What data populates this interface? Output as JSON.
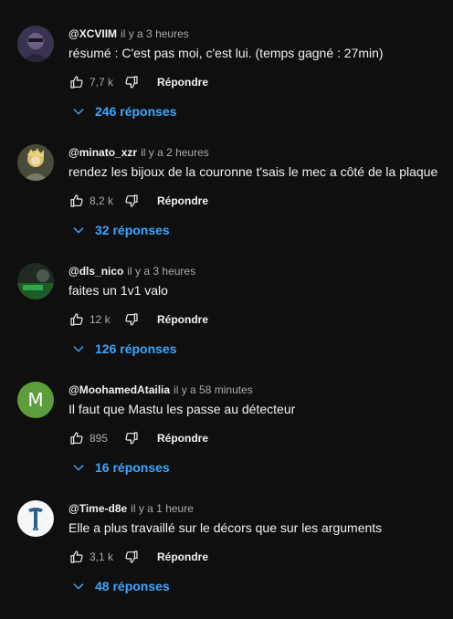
{
  "comments": [
    {
      "author": "@XCVIIM",
      "time": "il y a 3 heures",
      "text": "résumé : C'est pas moi, c'est lui. (temps gagné : 27min)",
      "likes": "7,7 k",
      "reply_label": "Répondre",
      "replies_label": "246 réponses",
      "avatar_icon": "photo-avatar"
    },
    {
      "author": "@minato_xzr",
      "time": "il y a 2 heures",
      "text": "rendez les bijoux de la couronne t'sais le mec a côté de la plaque",
      "likes": "8,2 k",
      "reply_label": "Répondre",
      "replies_label": "32 réponses",
      "avatar_icon": "photo-avatar"
    },
    {
      "author": "@dls_nico",
      "time": "il y a 3 heures",
      "text": "faites un 1v1 valo",
      "likes": "12 k",
      "reply_label": "Répondre",
      "replies_label": "126 réponses",
      "avatar_icon": "photo-avatar"
    },
    {
      "author": "@MoohamedAtailia",
      "time": "il y a 58 minutes",
      "text": "Il faut que Mastu les passe au détecteur",
      "likes": "895",
      "reply_label": "Répondre",
      "replies_label": "16 réponses",
      "avatar_letter": "M",
      "avatar_color": "#5c9e3b"
    },
    {
      "author": "@Time-d8e",
      "time": "il y a 1 heure",
      "text": "Elle a plus travaillé sur le décors que sur les arguments",
      "likes": "3,1 k",
      "reply_label": "Répondre",
      "replies_label": "48 réponses",
      "avatar_icon": "photo-avatar"
    }
  ],
  "colors": {
    "background": "#0f0f0f",
    "text": "#f1f1f1",
    "secondary_text": "#aaaaaa",
    "link_blue": "#3ea6ff"
  },
  "icons": {
    "like": "thumbs-up-icon",
    "dislike": "thumbs-down-icon",
    "expand": "chevron-down-icon"
  }
}
